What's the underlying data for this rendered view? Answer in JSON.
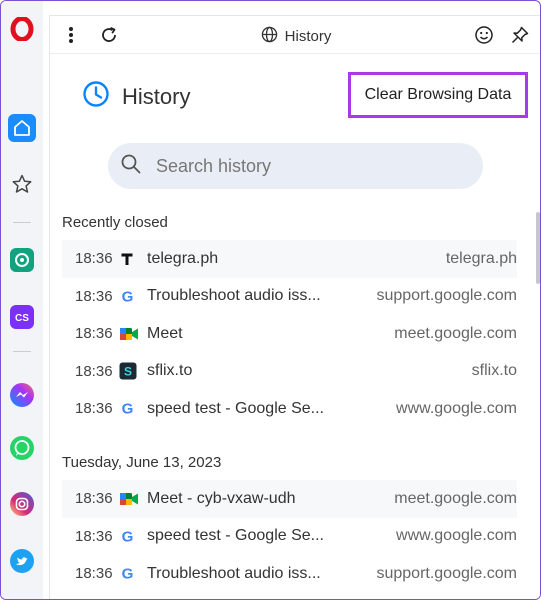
{
  "topbar": {
    "title": "History"
  },
  "header": {
    "title": "History",
    "clear_button": "Clear Browsing Data"
  },
  "search": {
    "placeholder": "Search history",
    "value": ""
  },
  "sections": [
    {
      "title": "Recently closed",
      "items": [
        {
          "time": "18:36",
          "title": "telegra.ph",
          "domain": "telegra.ph",
          "favicon": "telegraph-icon"
        },
        {
          "time": "18:36",
          "title": "Troubleshoot audio iss...",
          "domain": "support.google.com",
          "favicon": "google-icon"
        },
        {
          "time": "18:36",
          "title": "Meet",
          "domain": "meet.google.com",
          "favicon": "google-meet-icon"
        },
        {
          "time": "18:36",
          "title": "sflix.to",
          "domain": "sflix.to",
          "favicon": "sflix-icon"
        },
        {
          "time": "18:36",
          "title": "speed test - Google Se...",
          "domain": "www.google.com",
          "favicon": "google-icon"
        }
      ]
    },
    {
      "title": "Tuesday, June 13, 2023",
      "items": [
        {
          "time": "18:36",
          "title": "Meet - cyb-vxaw-udh",
          "domain": "meet.google.com",
          "favicon": "google-meet-icon"
        },
        {
          "time": "18:36",
          "title": "speed test - Google Se...",
          "domain": "www.google.com",
          "favicon": "google-icon"
        },
        {
          "time": "18:36",
          "title": "Troubleshoot audio iss...",
          "domain": "support.google.com",
          "favicon": "google-icon"
        }
      ]
    }
  ],
  "sidebar": {
    "items": [
      "opera-logo-icon",
      "home-icon",
      "star-icon",
      "chatgpt-icon",
      "cs-app-icon",
      "messenger-icon",
      "whatsapp-icon",
      "instagram-icon",
      "twitter-icon"
    ]
  },
  "colors": {
    "accent": "#0a84ff",
    "highlight_border": "#a93be6",
    "search_bg": "#e9eef6"
  }
}
